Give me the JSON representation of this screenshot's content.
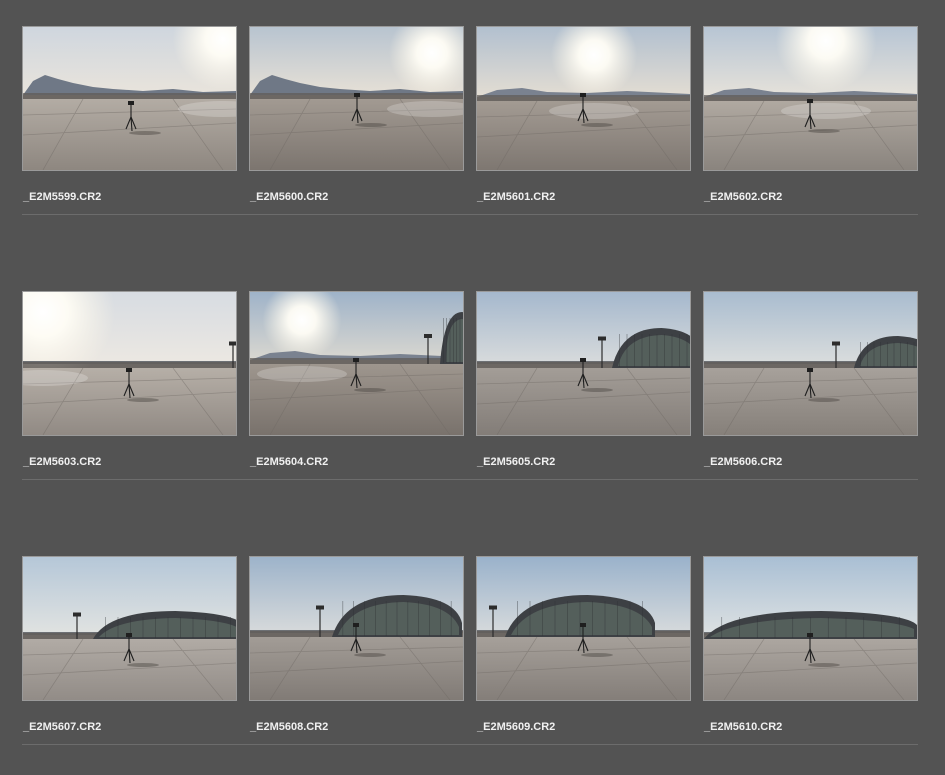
{
  "grid": {
    "rows": [
      {
        "items": [
          {
            "filename": "_E2M5599.CR2",
            "scene": "sunset-mountains"
          },
          {
            "filename": "_E2M5600.CR2",
            "scene": "sun-low-mountains"
          },
          {
            "filename": "_E2M5601.CR2",
            "scene": "sun-center-flat"
          },
          {
            "filename": "_E2M5602.CR2",
            "scene": "sun-top-right"
          }
        ]
      },
      {
        "items": [
          {
            "filename": "_E2M5603.CR2",
            "scene": "sun-left-haze"
          },
          {
            "filename": "_E2M5604.CR2",
            "scene": "sun-hangar-edge"
          },
          {
            "filename": "_E2M5605.CR2",
            "scene": "hangar-right"
          },
          {
            "filename": "_E2M5606.CR2",
            "scene": "hangar-right-large"
          }
        ]
      },
      {
        "items": [
          {
            "filename": "_E2M5607.CR2",
            "scene": "hangar-full"
          },
          {
            "filename": "_E2M5608.CR2",
            "scene": "hangar-far"
          },
          {
            "filename": "_E2M5609.CR2",
            "scene": "hangar-far-trees"
          },
          {
            "filename": "_E2M5610.CR2",
            "scene": "hangar-close"
          }
        ]
      }
    ]
  },
  "colors": {
    "background": "#535353",
    "border": "#9a9a9a",
    "text": "#f0f0f0",
    "separator": "#6c6c6c"
  }
}
